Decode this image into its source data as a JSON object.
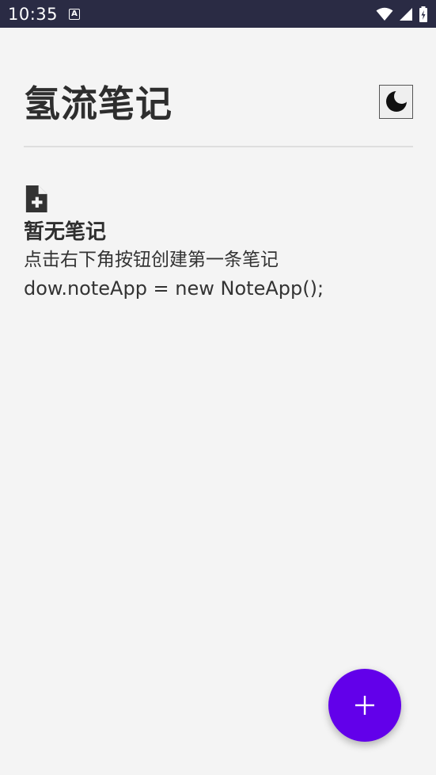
{
  "status_bar": {
    "time": "10:35",
    "app_icon_letter": "A",
    "icons": [
      "wifi-icon",
      "signal-icon",
      "battery-icon"
    ]
  },
  "header": {
    "title": "氢流笔记",
    "theme_toggle_icon": "moon-icon"
  },
  "empty_state": {
    "icon": "note-add-icon",
    "title": "暂无笔记",
    "description": "点击右下角按钮创建第一条笔记",
    "code_text": "dow.noteApp = new NoteApp();"
  },
  "fab": {
    "icon": "plus-icon",
    "color": "#6200ea"
  },
  "colors": {
    "background": "#f4f4f4",
    "status_bar": "#2a2b44",
    "accent": "#6200ea"
  }
}
